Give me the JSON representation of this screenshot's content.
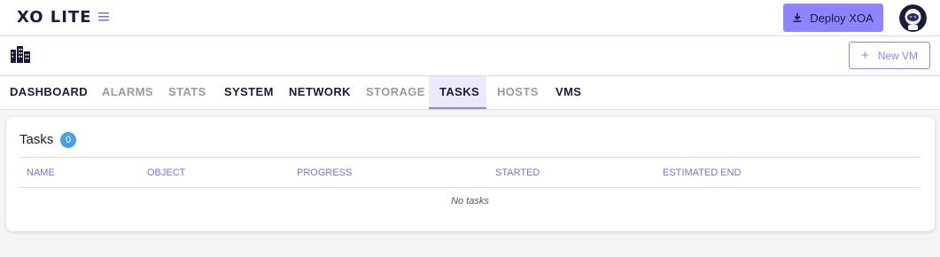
{
  "header": {
    "logo": "XO LITE",
    "deploy_label": "Deploy XOA"
  },
  "pagebar": {
    "new_vm_label": "New VM"
  },
  "tabs": [
    {
      "label": "DASHBOARD",
      "state": "normal"
    },
    {
      "label": "ALARMS",
      "state": "muted"
    },
    {
      "label": "STATS",
      "state": "muted"
    },
    {
      "label": "SYSTEM",
      "state": "normal"
    },
    {
      "label": "NETWORK",
      "state": "normal"
    },
    {
      "label": "STORAGE",
      "state": "muted"
    },
    {
      "label": "TASKS",
      "state": "active"
    },
    {
      "label": "HOSTS",
      "state": "muted"
    },
    {
      "label": "VMS",
      "state": "normal"
    }
  ],
  "tasks": {
    "title": "Tasks",
    "count": "0",
    "columns": [
      "NAME",
      "OBJECT",
      "PROGRESS",
      "STARTED",
      "ESTIMATED END"
    ],
    "empty_text": "No tasks"
  },
  "colors": {
    "accent": "#8f84ff",
    "badge": "#4b9fe8",
    "text": "#1a1b38"
  }
}
